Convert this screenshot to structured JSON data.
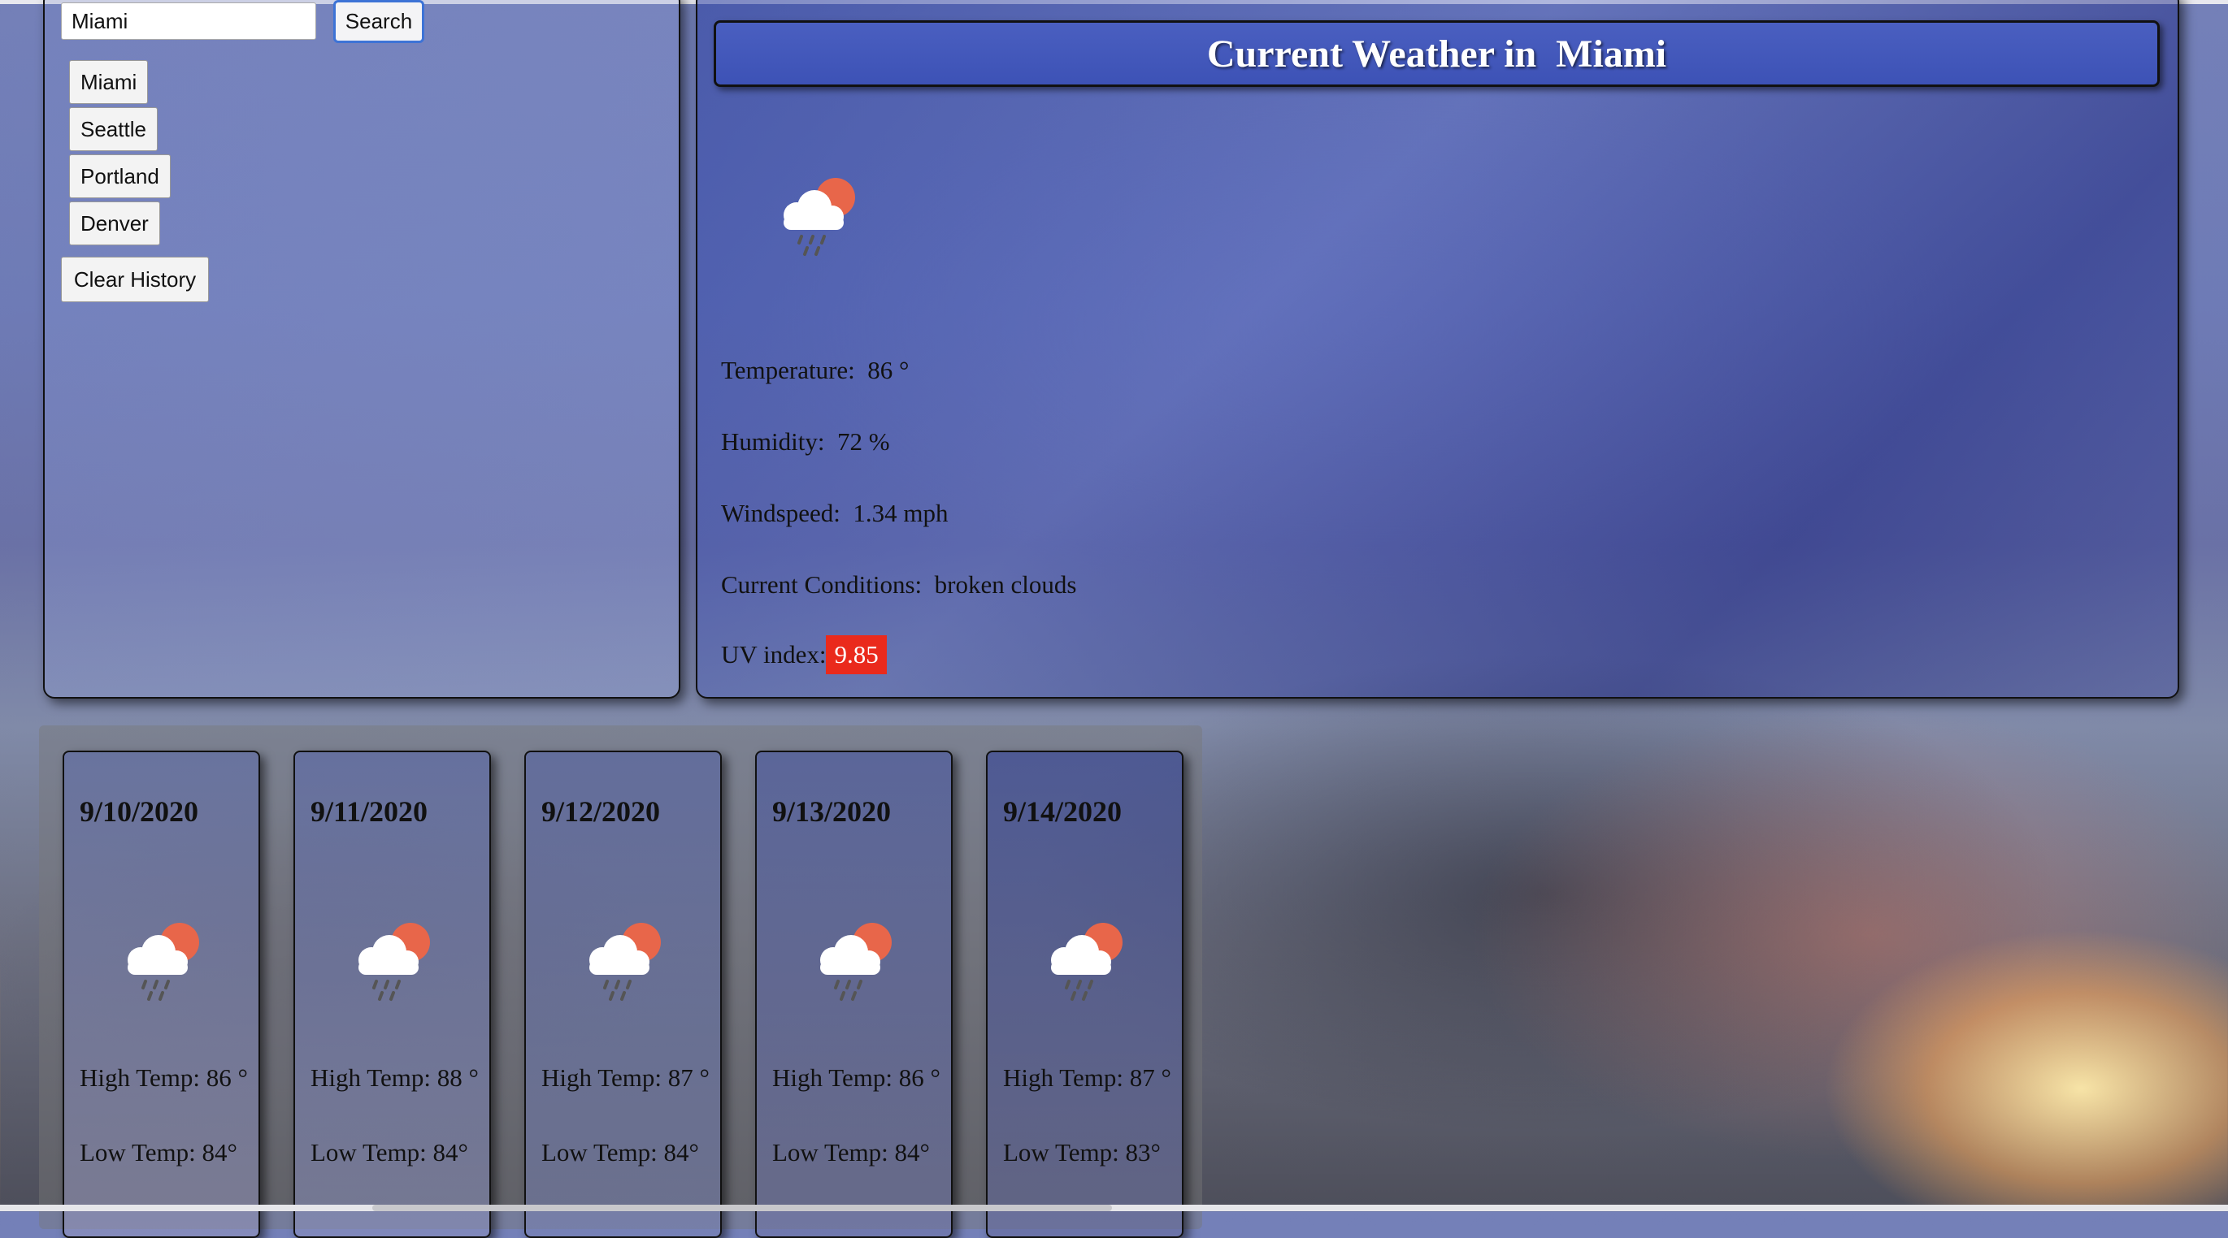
{
  "search": {
    "input_value": "Miami",
    "button_label": "Search"
  },
  "history": {
    "cities": [
      "Miami",
      "Seattle",
      "Portland",
      "Denver"
    ],
    "clear_label": "Clear History"
  },
  "current": {
    "title": "Current Weather in  Miami",
    "icon": "cloud-sun-rain-icon",
    "temperature": {
      "label": "Temperature:",
      "value": "86 °"
    },
    "humidity": {
      "label": "Humidity:",
      "value": "72 %"
    },
    "windspeed": {
      "label": "Windspeed:",
      "value": "1.34 mph"
    },
    "conditions": {
      "label": "Current Conditions:",
      "value": "broken clouds"
    },
    "uv": {
      "label": "UV index:",
      "value": "9.85",
      "color": "#ea2a1c"
    }
  },
  "forecast": [
    {
      "date": "9/10/2020",
      "icon": "cloud-sun-rain-icon",
      "high": "High Temp: 86 °",
      "low": "Low Temp: 84°"
    },
    {
      "date": "9/11/2020",
      "icon": "cloud-sun-rain-icon",
      "high": "High Temp: 88 °",
      "low": "Low Temp: 84°"
    },
    {
      "date": "9/12/2020",
      "icon": "cloud-sun-rain-icon",
      "high": "High Temp: 87 °",
      "low": "Low Temp: 84°"
    },
    {
      "date": "9/13/2020",
      "icon": "cloud-sun-rain-icon",
      "high": "High Temp: 86 °",
      "low": "Low Temp: 84°"
    },
    {
      "date": "9/14/2020",
      "icon": "cloud-sun-rain-icon",
      "high": "High Temp: 87 °",
      "low": "Low Temp: 83°"
    }
  ]
}
